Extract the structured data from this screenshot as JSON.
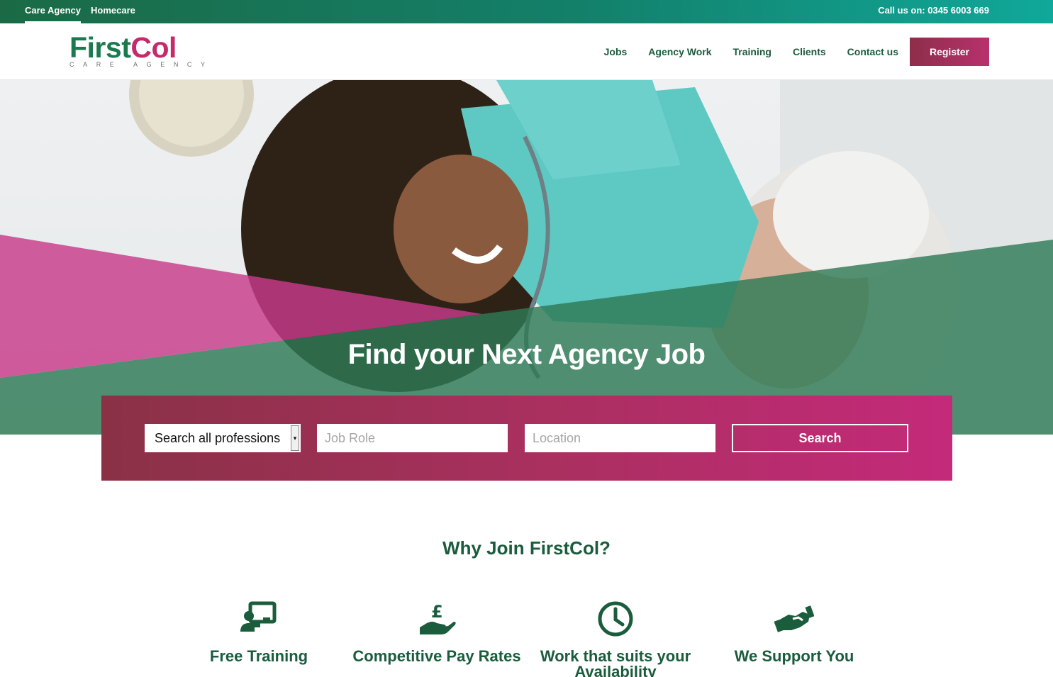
{
  "topbar": {
    "tabs": [
      {
        "label": "Care Agency",
        "active": true
      },
      {
        "label": "Homecare",
        "active": false
      }
    ],
    "phone": "Call us on: 0345 6003 669"
  },
  "logo": {
    "word1": "First",
    "word2": "Col",
    "subtitle": "CARE AGENCY"
  },
  "nav": {
    "items": [
      "Jobs",
      "Agency Work",
      "Training",
      "Clients",
      "Contact us"
    ],
    "register": "Register"
  },
  "hero": {
    "title": "Find your Next Agency Job"
  },
  "search": {
    "profession": "Search all professions",
    "job_role_placeholder": "Job Role",
    "location_placeholder": "Location",
    "button": "Search"
  },
  "why": {
    "title": "Why Join FirstCol?",
    "features": [
      {
        "icon": "training-icon",
        "label": "Free Training"
      },
      {
        "icon": "pay-icon",
        "label": "Competitive Pay Rates"
      },
      {
        "icon": "clock-icon",
        "label": "Work that suits your Availability"
      },
      {
        "icon": "handshake-icon",
        "label": "We Support You"
      }
    ]
  },
  "colors": {
    "brand_green": "#1a7a4e",
    "brand_pink": "#c62a6b",
    "dark_green": "#1a5c3c",
    "teal": "#10a89a"
  }
}
